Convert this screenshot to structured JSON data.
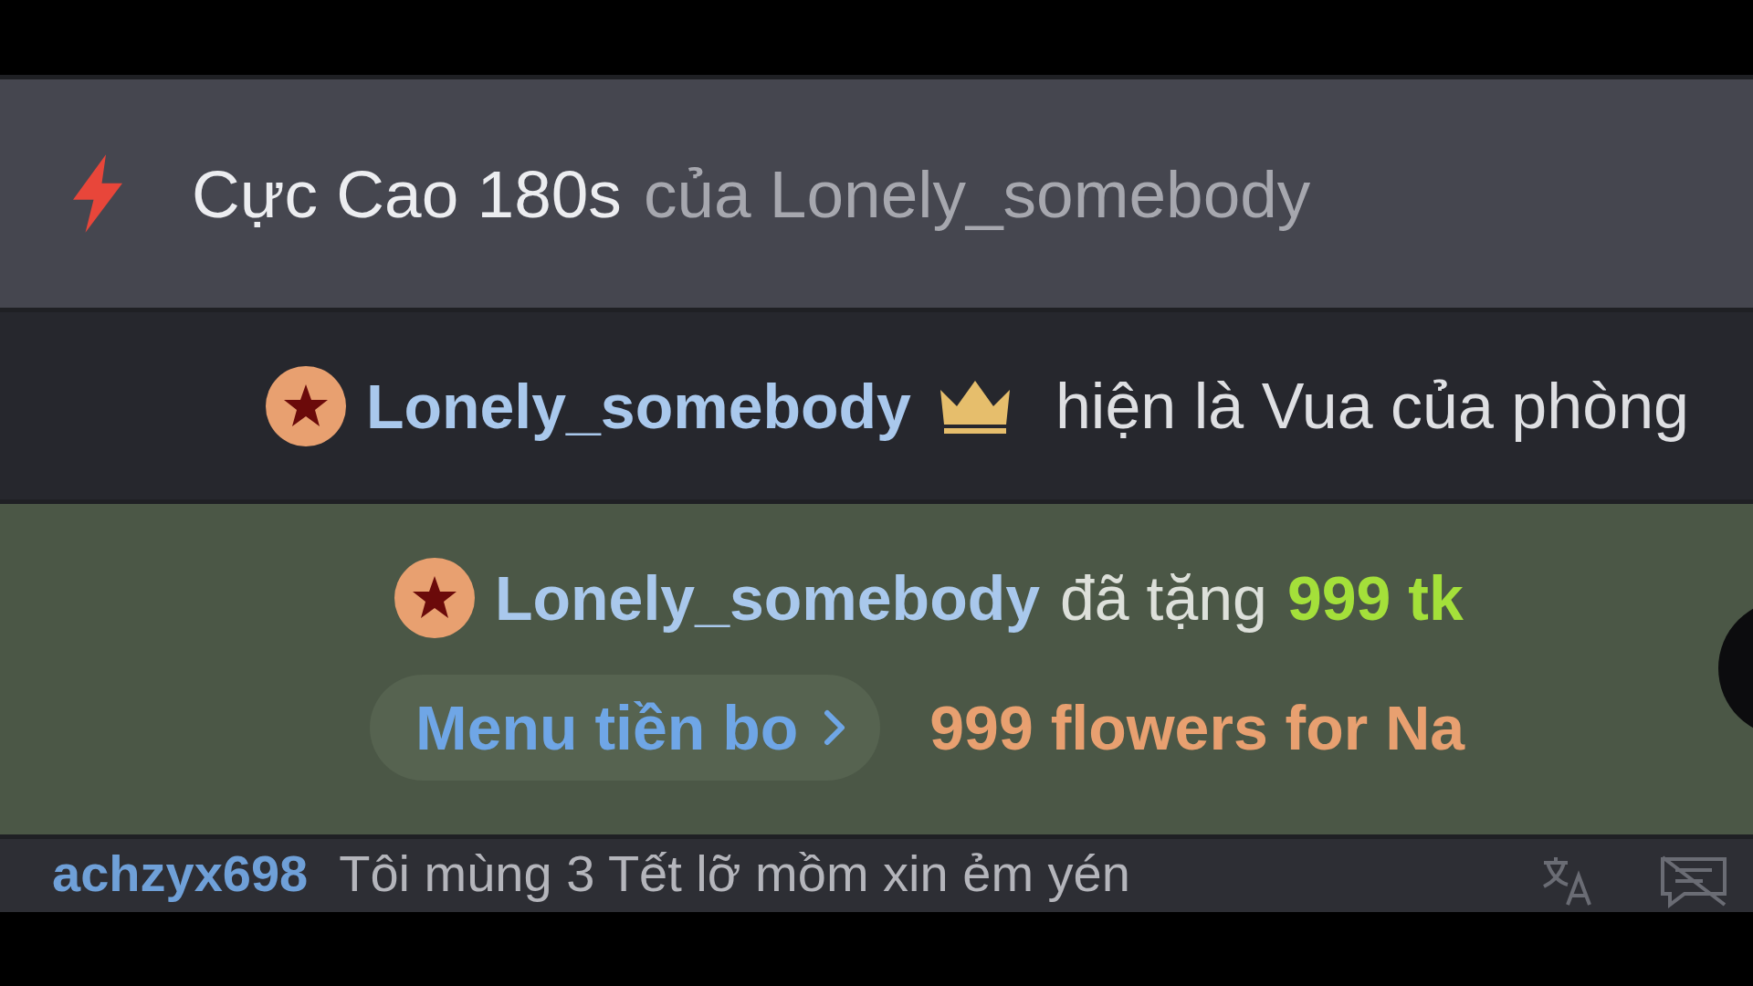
{
  "boost": {
    "title": "Cực Cao 180s",
    "suffix": "của Lonely_somebody"
  },
  "king": {
    "username": "Lonely_somebody",
    "text": "hiện là Vua của phòng"
  },
  "gift": {
    "username": "Lonely_somebody",
    "verb": "đã tặng",
    "amount": "999 tk",
    "menu_button": "Menu tiền bo",
    "gift_name": "999 flowers for Na"
  },
  "chat": {
    "username": "achzyx698",
    "message": "Tôi mùng 3 Tết lỡ mồm xin ẻm yén"
  }
}
